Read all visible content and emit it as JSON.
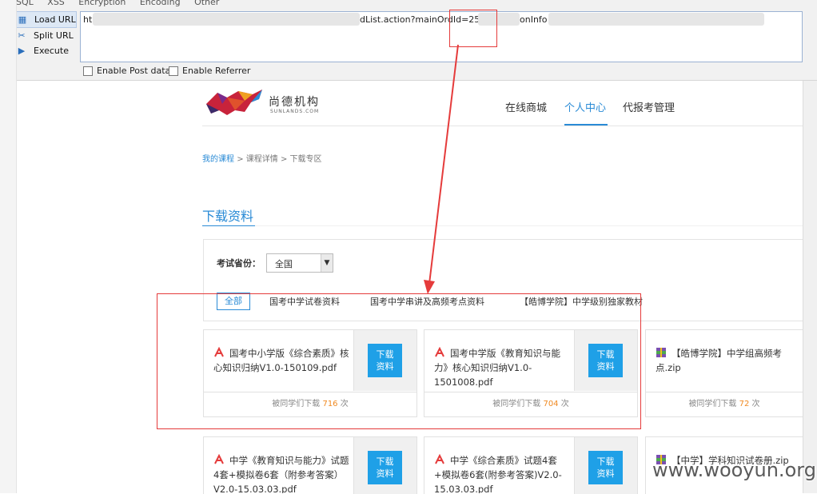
{
  "toolbar": {
    "menu": [
      "SQL",
      "XSS",
      "Encryption",
      "Encoding",
      "Other"
    ],
    "tools": [
      {
        "label": "Load URL",
        "icon": "load-url-icon"
      },
      {
        "label": "Split URL",
        "icon": "split-url-icon"
      },
      {
        "label": "Execute",
        "icon": "execute-icon"
      }
    ],
    "url_left": "ht",
    "url_mid": "dList.action?mainOrdId=25371",
    "url_right": "onInfo",
    "enable_post": "Enable Post data",
    "enable_referrer": "Enable Referrer"
  },
  "site": {
    "logo_text": "尚德机构",
    "logo_sub": "SUNLANDS.COM",
    "nav": [
      "在线商城",
      "个人中心",
      "代报考管理"
    ],
    "active_nav": "个人中心"
  },
  "breadcrumb": {
    "first": "我的课程",
    "sep1": ">",
    "second": "课程详情",
    "sep2": ">",
    "third": "下载专区"
  },
  "section_title": "下载资料",
  "filter": {
    "label": "考试省份：",
    "selected": "全国",
    "tabs": [
      "全部",
      "国考中学试卷资料",
      "国考中学串讲及高频考点资料",
      "【皓博学院】中学级别独家教材"
    ]
  },
  "download_label_1": "下载",
  "download_label_2": "资料",
  "cards": [
    {
      "name": "国考中小学版《综合素质》核心知识归纳V1.0-150109.pdf",
      "prefix": "被同学们下载",
      "count": "716",
      "suffix": "次",
      "type": "pdf"
    },
    {
      "name": "国考中学版《教育知识与能力》核心知识归纳V1.0-1501008.pdf",
      "prefix": "被同学们下载",
      "count": "704",
      "suffix": "次",
      "type": "pdf"
    },
    {
      "name": "【皓博学院】中学组高频考点.zip",
      "prefix": "被同学们下载",
      "count": "72",
      "suffix": "次",
      "type": "zip"
    },
    {
      "name": "中学《教育知识与能力》试题4套+模拟卷6套（附参考答案）V2.0-15.03.03.pdf",
      "type": "pdf"
    },
    {
      "name": "中学《综合素质》试题4套+模拟卷6套(附参考答案)V2.0-15.03.03.pdf",
      "type": "pdf"
    },
    {
      "name": "【中学】学科知识试卷册.zip",
      "type": "zip"
    }
  ],
  "watermark": "www.wooyun.org",
  "colors": {
    "accent": "#2a8bd6",
    "button": "#1fa0e7",
    "count": "#f08a22",
    "annotation": "#e53b3b"
  }
}
